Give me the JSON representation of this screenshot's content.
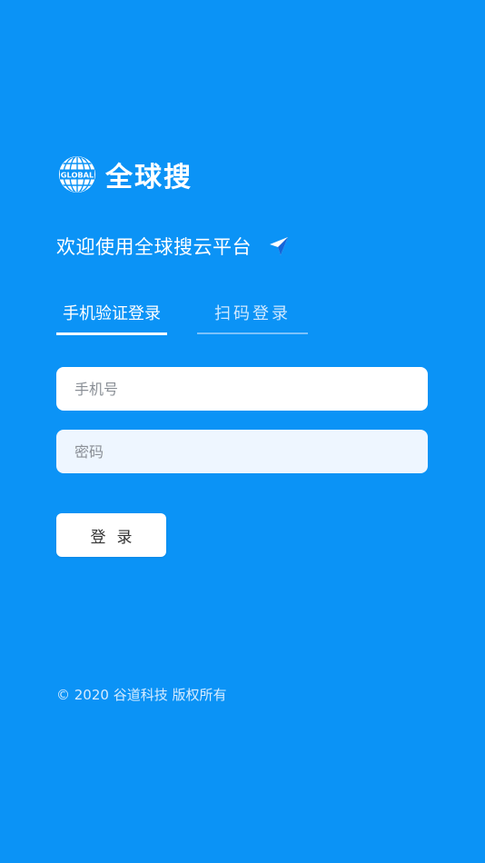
{
  "logo": {
    "globe_text": "GLOBAL",
    "brand_name": "全球搜"
  },
  "welcome": {
    "text": "欢迎使用全球搜云平台",
    "icon": "send-icon"
  },
  "tabs": [
    {
      "label": "手机验证登录",
      "active": true
    },
    {
      "label": "扫码登录",
      "active": false
    }
  ],
  "form": {
    "phone_placeholder": "手机号",
    "phone_value": "",
    "password_placeholder": "密码",
    "password_value": "",
    "login_label": "登录"
  },
  "footer": {
    "copyright": "© 2020 谷道科技 版权所有"
  },
  "colors": {
    "background": "#0b93f6",
    "accent_icon": "#1565d8",
    "text": "#ffffff"
  }
}
